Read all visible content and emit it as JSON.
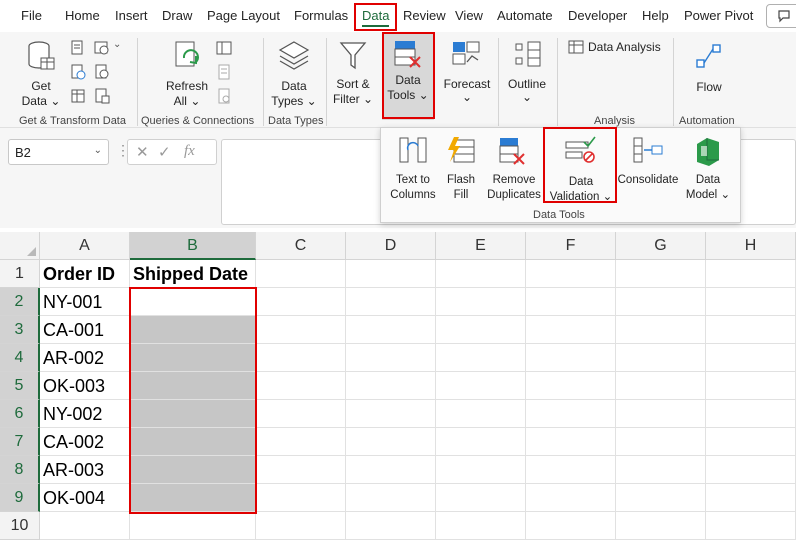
{
  "menu": {
    "items": [
      "File",
      "Home",
      "Insert",
      "Draw",
      "Page Layout",
      "Formulas",
      "Data",
      "Review",
      "View",
      "Automate",
      "Developer",
      "Help",
      "Power Pivot"
    ],
    "active": "Data"
  },
  "ribbon": {
    "get_data": "Get",
    "get_data_2": "Data",
    "refresh": "Refresh",
    "refresh_2": "All",
    "data_types": "Data",
    "data_types_2": "Types",
    "sort": "Sort &",
    "sort_2": "Filter",
    "data_tools": "Data",
    "data_tools_2": "Tools",
    "forecast": "Forecast",
    "outline": "Outline",
    "data_analysis": "Data Analysis",
    "flow": "Flow",
    "groups": {
      "get_transform": "Get & Transform Data",
      "queries": "Queries & Connections",
      "data_types": "Data Types",
      "analysis": "Analysis",
      "automation": "Automation"
    }
  },
  "formula_bar": {
    "name_box": "B2",
    "fx": "fx"
  },
  "dropdown": {
    "text_to_columns": "Text to",
    "text_to_columns_2": "Columns",
    "flash_fill": "Flash",
    "flash_fill_2": "Fill",
    "remove_dup": "Remove",
    "remove_dup_2": "Duplicates",
    "data_validation": "Data",
    "data_validation_2": "Validation",
    "consolidate": "Consolidate",
    "data_model": "Data",
    "data_model_2": "Model",
    "group_label": "Data Tools"
  },
  "sheet": {
    "columns": [
      "A",
      "B",
      "C",
      "D",
      "E",
      "F",
      "G",
      "H"
    ],
    "rows": [
      "1",
      "2",
      "3",
      "4",
      "5",
      "6",
      "7",
      "8",
      "9",
      "10"
    ],
    "header_a": "Order ID",
    "header_b": "Shipped Date",
    "order_ids": [
      "NY-001",
      "CA-001",
      "AR-002",
      "OK-003",
      "NY-002",
      "CA-002",
      "AR-003",
      "OK-004"
    ]
  },
  "colors": {
    "accent_green": "#1e6b3c",
    "highlight_red": "#e00000",
    "selection_fill": "#c6c6c6"
  }
}
